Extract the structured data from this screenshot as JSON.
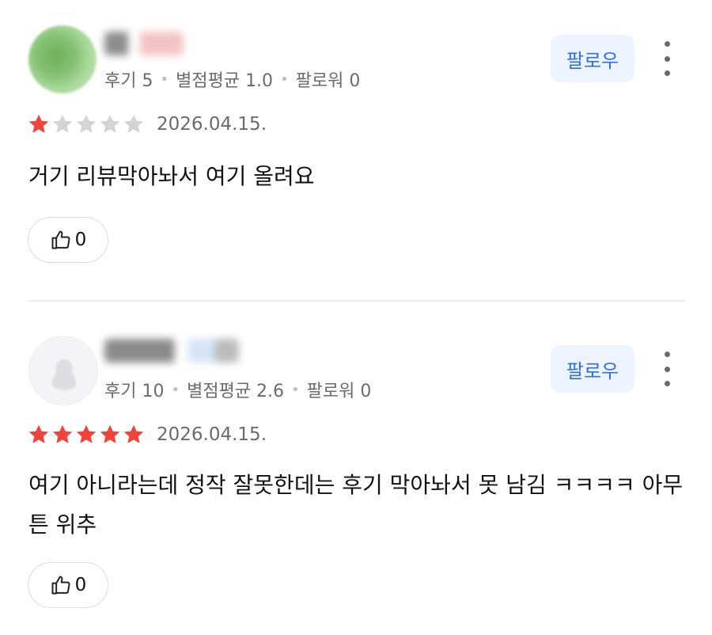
{
  "reviews": [
    {
      "stats": {
        "reviews_label": "후기 5",
        "rating_label": "별점평균 1.0",
        "followers_label": "팔로워 0"
      },
      "follow_label": "팔로우",
      "rating": 1,
      "date": "2026.04.15.",
      "text": "거기 리뷰막아놔서 여기 올려요",
      "likes": "0"
    },
    {
      "stats": {
        "reviews_label": "후기 10",
        "rating_label": "별점평균 2.6",
        "followers_label": "팔로워 0"
      },
      "follow_label": "팔로우",
      "rating": 5,
      "date": "2026.04.15.",
      "text": "여기 아니라는데 정작 잘못한데는 후기 막아놔서 못 남김 ㅋㅋㅋㅋ 아무튼 위추",
      "likes": "0"
    }
  ],
  "colors": {
    "star_filled": "#f0433a",
    "star_empty": "#d4d4d4",
    "follow_bg": "#eef4ff",
    "follow_text": "#2f6fe4"
  },
  "icons": {
    "like": "thumbs-up-icon",
    "more": "more-vertical-icon",
    "star": "star-icon"
  }
}
